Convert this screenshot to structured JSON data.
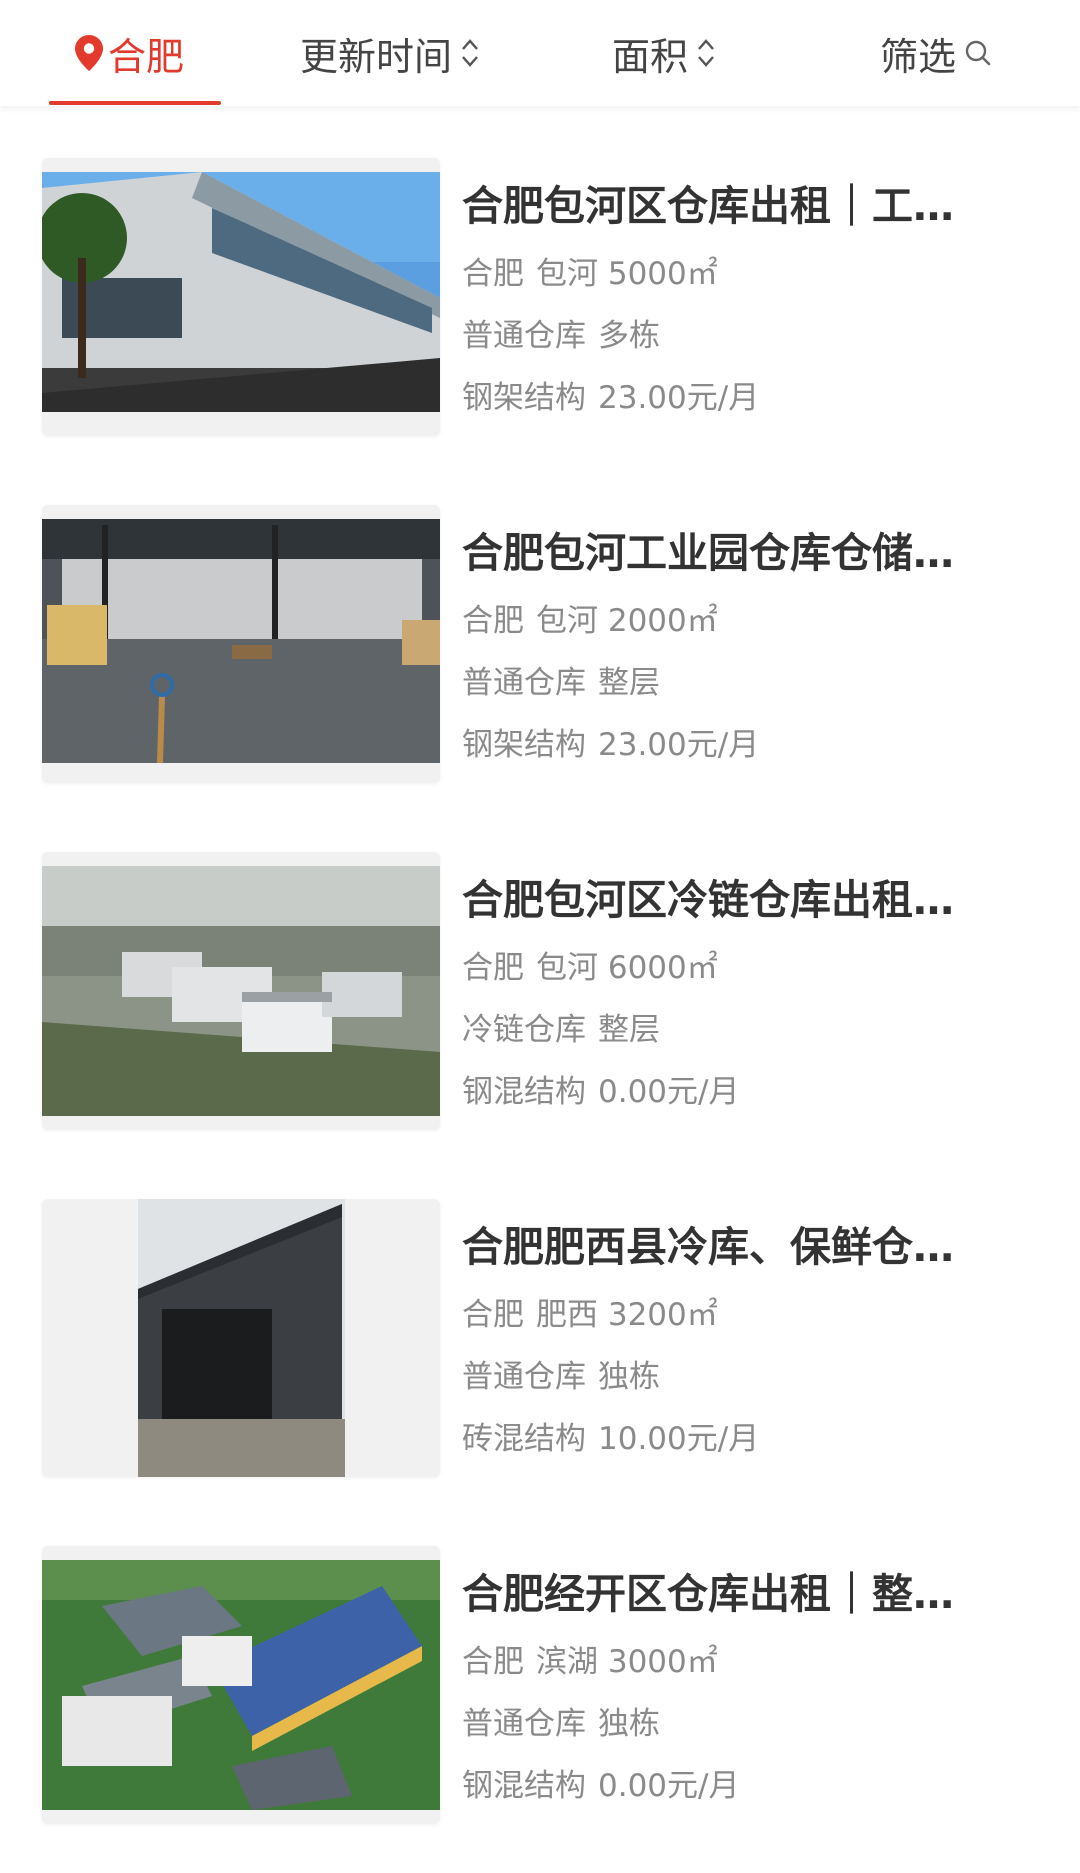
{
  "filter_bar": {
    "city": "合肥",
    "update_time": "更新时间",
    "area": "面积",
    "filter": "筛选",
    "accent_color": "#e23b2e"
  },
  "listings": [
    {
      "title": "合肥包河区仓库出租｜工…",
      "city": "合肥",
      "district": "包河",
      "area": "5000㎡",
      "type": "普通仓库",
      "floor": "多栋",
      "structure": "钢架结构",
      "price": "23.00元/月"
    },
    {
      "title": "合肥包河工业园仓库仓储…",
      "city": "合肥",
      "district": "包河",
      "area": "2000㎡",
      "type": "普通仓库",
      "floor": "整层",
      "structure": "钢架结构",
      "price": "23.00元/月"
    },
    {
      "title": "合肥包河区冷链仓库出租…",
      "city": "合肥",
      "district": "包河",
      "area": "6000㎡",
      "type": "冷链仓库",
      "floor": "整层",
      "structure": "钢混结构",
      "price": "0.00元/月"
    },
    {
      "title": "合肥肥西县冷库、保鲜仓…",
      "city": "合肥",
      "district": "肥西",
      "area": "3200㎡",
      "type": "普通仓库",
      "floor": "独栋",
      "structure": "砖混结构",
      "price": "10.00元/月"
    },
    {
      "title": "合肥经开区仓库出租｜整…",
      "city": "合肥",
      "district": "滨湖",
      "area": "3000㎡",
      "type": "普通仓库",
      "floor": "独栋",
      "structure": "钢混结构",
      "price": "0.00元/月"
    }
  ]
}
